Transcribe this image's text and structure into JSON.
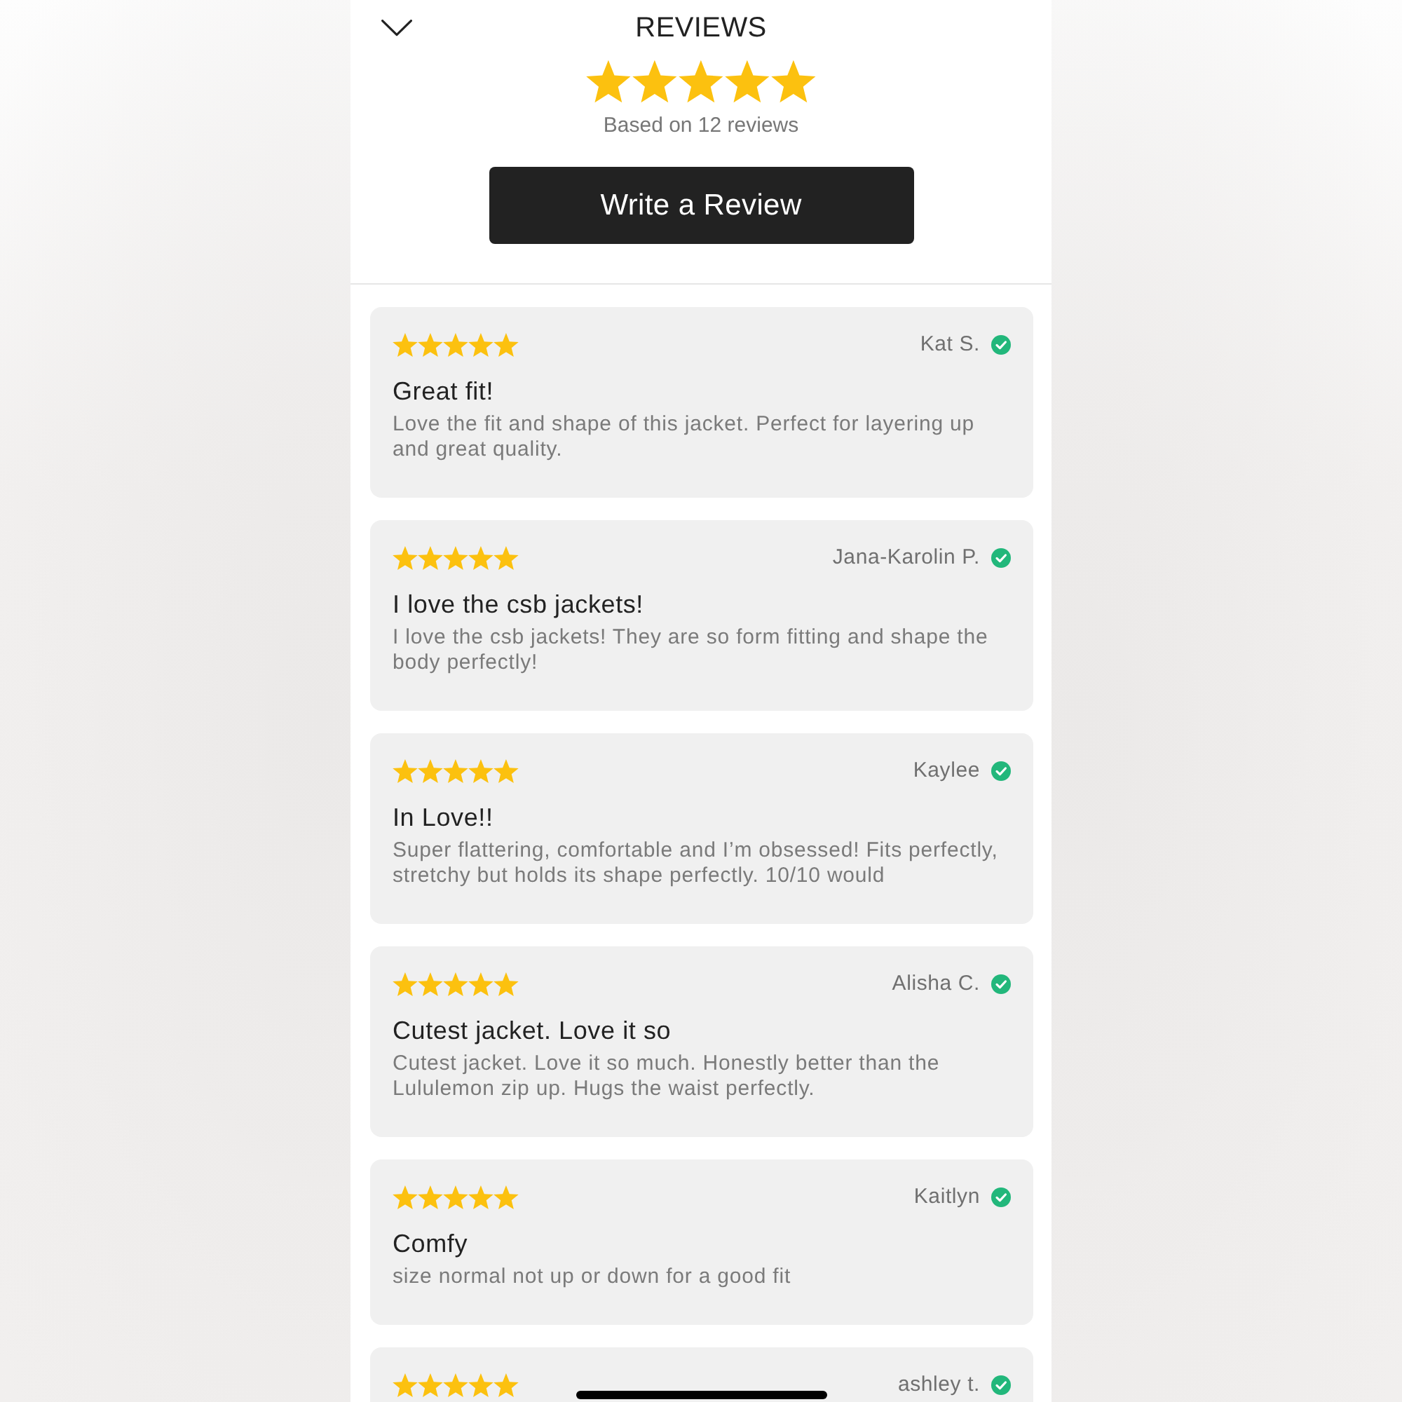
{
  "header": {
    "title": "REVIEWS",
    "stars": 5,
    "summary": "Based on 12 reviews",
    "button": "Write a Review"
  },
  "reviews": [
    {
      "stars": 5,
      "author": "Kat S.",
      "verified": true,
      "title": "Great fit!",
      "body": "Love the fit and shape of this jacket. Perfect for layering up and great quality."
    },
    {
      "stars": 5,
      "author": "Jana-Karolin P.",
      "verified": true,
      "title": "I love the csb jackets!",
      "body": "I love the csb jackets! They are so form fitting and shape the body perfectly!"
    },
    {
      "stars": 5,
      "author": "Kaylee",
      "verified": true,
      "title": "In Love!!",
      "body": "Super flattering, comfortable and I’m obsessed! Fits perfectly, stretchy but holds its shape perfectly. 10/10 would"
    },
    {
      "stars": 5,
      "author": "Alisha C.",
      "verified": true,
      "title": "Cutest jacket. Love it so",
      "body": "Cutest jacket. Love it so much. Honestly better than the Lululemon zip up. Hugs the waist perfectly."
    },
    {
      "stars": 5,
      "author": "Kaitlyn",
      "verified": true,
      "title": "Comfy",
      "body": "size normal not up or down for a good fit"
    },
    {
      "stars": 5,
      "author": "ashley t.",
      "verified": true
    }
  ]
}
